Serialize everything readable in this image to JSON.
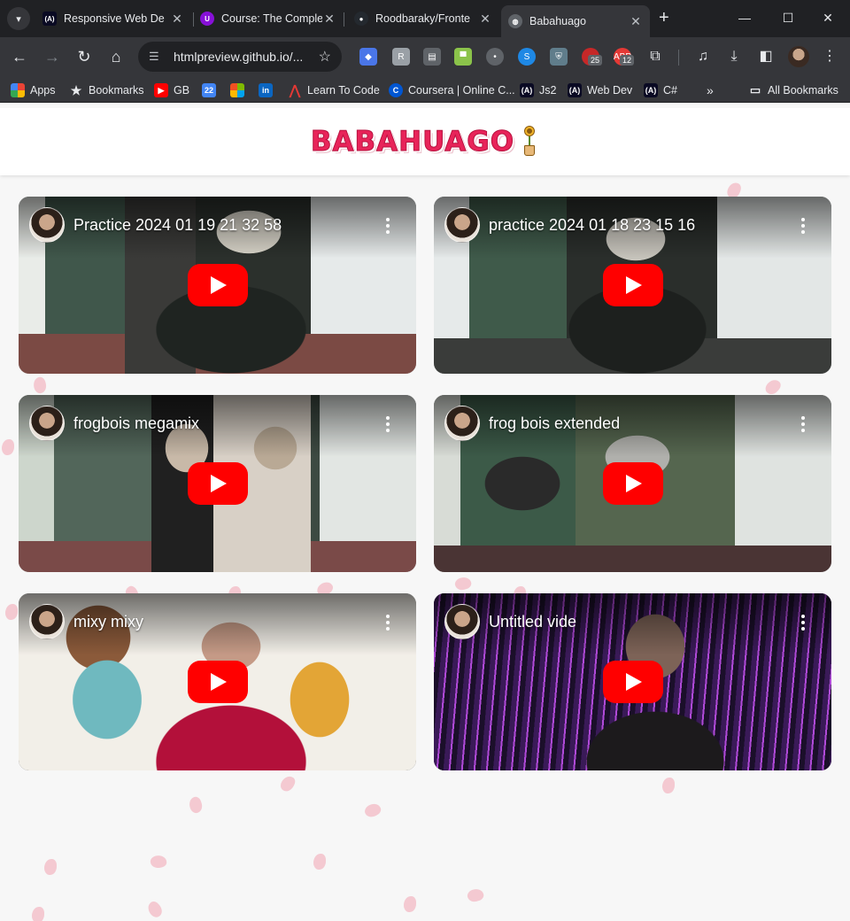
{
  "browser": {
    "tabs": [
      {
        "title": "Responsive Web De",
        "icon": "freecodecamp-icon",
        "active": false
      },
      {
        "title": "Course: The Comple",
        "icon": "udemy-icon",
        "active": false
      },
      {
        "title": "Roodbaraky/Fronte",
        "icon": "github-icon",
        "active": false
      },
      {
        "title": "Babahuago",
        "icon": "globe-icon",
        "active": true
      }
    ],
    "url": "htmlpreview.github.io/...",
    "extension_badges": [
      "25",
      "12"
    ],
    "bookmarks": [
      {
        "label": "Apps",
        "icon": "apps-grid-icon"
      },
      {
        "label": "Bookmarks",
        "icon": "star-icon"
      },
      {
        "label": "GB",
        "icon": "youtube-icon"
      },
      {
        "label": "",
        "icon": "calendar-icon"
      },
      {
        "label": "",
        "icon": "microsoft-icon"
      },
      {
        "label": "",
        "icon": "linkedin-icon"
      },
      {
        "label": "Learn To Code",
        "icon": "learn-to-code-icon"
      },
      {
        "label": "Coursera | Online C...",
        "icon": "coursera-icon"
      },
      {
        "label": "Js2",
        "icon": "freecodecamp-icon"
      },
      {
        "label": "Web Dev",
        "icon": "freecodecamp-icon"
      },
      {
        "label": "C#",
        "icon": "freecodecamp-icon"
      }
    ],
    "all_bookmarks_label": "All Bookmarks"
  },
  "site": {
    "logo_text": "BABAHUAGO",
    "accent_color": "#e8245a"
  },
  "videos": [
    {
      "title": "Practice 2024 01 19 21 32 58"
    },
    {
      "title": "practice 2024 01 18 23 15 16"
    },
    {
      "title": "frogbois megamix"
    },
    {
      "title": "frog bois extended"
    },
    {
      "title": "mixy mixy"
    },
    {
      "title": "Untitled vide"
    }
  ]
}
